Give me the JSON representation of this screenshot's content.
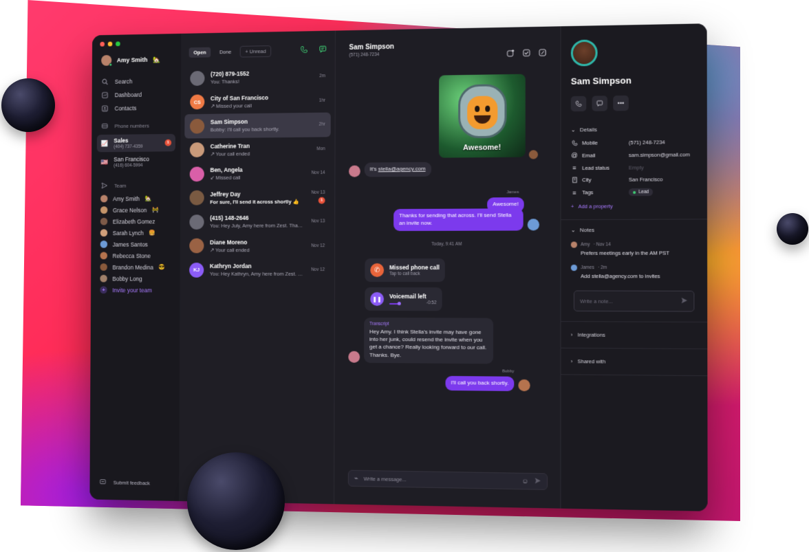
{
  "sidebar": {
    "user": {
      "name": "Amy Smith",
      "emoji": "🏡"
    },
    "nav": [
      {
        "label": "Search",
        "icon": "search-icon"
      },
      {
        "label": "Dashboard",
        "icon": "dashboard-icon"
      },
      {
        "label": "Contacts",
        "icon": "contacts-icon"
      }
    ],
    "phone_numbers_label": "Phone numbers",
    "phone_numbers": [
      {
        "name": "Sales",
        "number": "(404) 737-4359",
        "badge": "1"
      },
      {
        "name": "San Francisco",
        "number": "(416) 604-5994"
      }
    ],
    "team_label": "Team",
    "team": [
      {
        "name": "Amy Smith",
        "emoji": "🏡"
      },
      {
        "name": "Grace Nelson",
        "emoji": "🚧"
      },
      {
        "name": "Elizabeth Gomez",
        "emoji": ""
      },
      {
        "name": "Sarah Lynch",
        "emoji": "🍔"
      },
      {
        "name": "James Santos",
        "emoji": ""
      },
      {
        "name": "Rebecca Stone",
        "emoji": ""
      },
      {
        "name": "Brandon Medina",
        "emoji": "😎"
      },
      {
        "name": "Bobby Long",
        "emoji": ""
      }
    ],
    "invite_label": "Invite your team",
    "feedback_label": "Submit feedback"
  },
  "conversations": {
    "tabs": {
      "open": "Open",
      "done": "Done",
      "unread": "+ Unread"
    },
    "items": [
      {
        "name": "(720) 879-1552",
        "preview": "You: Thanks!",
        "time": "2m",
        "avatar": "",
        "avatar_color": "#6b6a75"
      },
      {
        "name": "City of San Francisco",
        "preview": "↗ Missed your call",
        "time": "1hr",
        "avatar": "CS",
        "avatar_color": "#f07a45"
      },
      {
        "name": "Sam Simpson",
        "preview": "Bobby: I'll call you back shortly.",
        "time": "2hr",
        "avatar": "",
        "avatar_color": "#8a5a3c"
      },
      {
        "name": "Catherine Tran",
        "preview": "↗ Your call ended",
        "time": "Mon",
        "avatar": "",
        "avatar_color": "#c99a7a"
      },
      {
        "name": "Ben, Angela",
        "preview": "↙ Missed call",
        "time": "Nov 14",
        "avatar": "",
        "avatar_color": "#d95fa8"
      },
      {
        "name": "Jeffrey Day",
        "preview": "For sure, I'll send it across shortly 👍",
        "time": "Nov 13",
        "avatar": "",
        "avatar_color": "#7a5a42",
        "unread": "1"
      },
      {
        "name": "(415) 148-2646",
        "preview": "You: Hey July, Amy here from Zest. Than…",
        "time": "Nov 13",
        "avatar": "",
        "avatar_color": "#6b6a75"
      },
      {
        "name": "Diane Moreno",
        "preview": "↗ Your call ended",
        "time": "Nov 12",
        "avatar": "",
        "avatar_color": "#9a6244"
      },
      {
        "name": "Kathryn Jordan",
        "preview": "You: Hey Kathryn, Amy here from Zest. Thi…",
        "time": "Nov 12",
        "avatar": "KJ",
        "avatar_color": "#8b5cf6"
      }
    ]
  },
  "chat": {
    "name": "Sam Simpson",
    "number": "(571) 248-7234",
    "gif_caption": "Awesome!",
    "msg_email_prefix": "It's ",
    "msg_email": "stella@agency.com",
    "sender_james": "James",
    "msg_awesome": "Awesome!",
    "msg_thanks": "Thanks for sending that across. I'll send Stella an invite now.",
    "date_sep": "Today, 9:41 AM",
    "missed_title": "Missed phone call",
    "missed_sub": "Tap to call back",
    "vm_title": "Voicemail left",
    "vm_time": "-0:52",
    "vm_progress": 0.3,
    "transcript_label": "Transcript",
    "transcript_text": "Hey Amy. I think Stella's invite may have gone into her junk, could resend the invite when you get a chance? Really looking forward to our call. Thanks. Bye.",
    "sender_bobby": "Bobby",
    "msg_bobby": "I'll call you back shortly.",
    "composer_placeholder": "Write a message..."
  },
  "contact": {
    "name": "Sam Simpson",
    "details_label": "Details",
    "details": [
      {
        "label": "Mobile",
        "icon": "phone-icon",
        "value": "(571) 248-7234"
      },
      {
        "label": "Email",
        "icon": "at-icon",
        "value": "sam.simpson@gmail.com"
      },
      {
        "label": "Lead status",
        "icon": "list-icon",
        "value": "Empty"
      },
      {
        "label": "City",
        "icon": "building-icon",
        "value": "San Francisco"
      },
      {
        "label": "Tags",
        "icon": "list-icon",
        "value": "Lead"
      }
    ],
    "add_property": "Add a property",
    "notes_label": "Notes",
    "notes": [
      {
        "author": "Amy",
        "time": "· Nov 14",
        "text": "Prefers meetings early in the AM PST"
      },
      {
        "author": "James",
        "time": "· 2m",
        "text": "Add stella@agency.com to invites"
      }
    ],
    "note_placeholder": "Write a note...",
    "integrations_label": "Integrations",
    "shared_label": "Shared with"
  }
}
